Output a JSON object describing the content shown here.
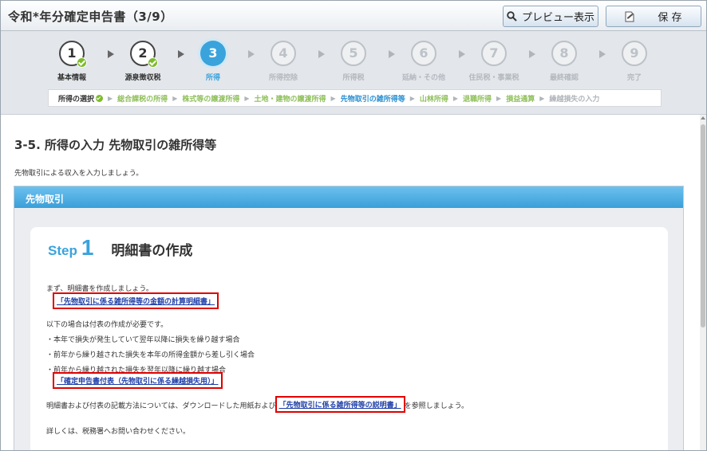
{
  "header": {
    "title": "令和*年分確定申告書（3/9）",
    "preview_label": "プレビュー表示",
    "save_label": "保 存"
  },
  "progress": {
    "steps": [
      {
        "num": "1",
        "label": "基本情報",
        "state": "done"
      },
      {
        "num": "2",
        "label": "源泉徴収税",
        "state": "done"
      },
      {
        "num": "3",
        "label": "所得",
        "state": "current"
      },
      {
        "num": "4",
        "label": "所得控除",
        "state": "future"
      },
      {
        "num": "5",
        "label": "所得税",
        "state": "future"
      },
      {
        "num": "6",
        "label": "延納・その他",
        "state": "future"
      },
      {
        "num": "7",
        "label": "住民税・事業税",
        "state": "future"
      },
      {
        "num": "8",
        "label": "最終確認",
        "state": "future"
      },
      {
        "num": "9",
        "label": "完了",
        "state": "future"
      }
    ],
    "substeps": [
      {
        "label": "所得の選択",
        "state": "first"
      },
      {
        "label": "総合課税の所得",
        "state": "done"
      },
      {
        "label": "株式等の譲渡所得",
        "state": "done"
      },
      {
        "label": "土地・建物の譲渡所得",
        "state": "done"
      },
      {
        "label": "先物取引の雑所得等",
        "state": "current"
      },
      {
        "label": "山林所得",
        "state": "done"
      },
      {
        "label": "退職所得",
        "state": "done"
      },
      {
        "label": "損益通算",
        "state": "done"
      },
      {
        "label": "繰越損失の入力",
        "state": "future"
      }
    ]
  },
  "content": {
    "heading": "3-5. 所得の入力 先物取引の雑所得等",
    "intro": "先物取引による収入を入力しましょう。",
    "section_title": "先物取引",
    "step_word": "Step",
    "step_number": "1",
    "step_heading": "明細書の作成",
    "line1": "まず、明細書を作成しましょう。",
    "link1": "「先物取引に係る雑所得等の金額の計算明細書」",
    "line2": "以下の場合は付表の作成が必要です。",
    "bullet1": "・本年で損失が発生していて翌年以降に損失を繰り越す場合",
    "bullet2": "・前年から繰り越された損失を本年の所得金額から差し引く場合",
    "bullet3": "・前年から繰り越された損失を翌年以降に繰り越す場合",
    "link2": "「確定申告書付表（先物取引に係る繰越損失用）」",
    "line3_pre": "明細書および付表の記載方法については、ダウンロードした用紙および",
    "link3": "「先物取引に係る雑所得等の説明書」",
    "line3_post": "を参照しましょう。",
    "line4": "詳しくは、税務署へお問い合わせください。"
  },
  "colors": {
    "accent": "#3aa3dc",
    "done_check": "#7cbc2a",
    "link": "#1f3fa8",
    "highlight_box": "#e00000"
  }
}
